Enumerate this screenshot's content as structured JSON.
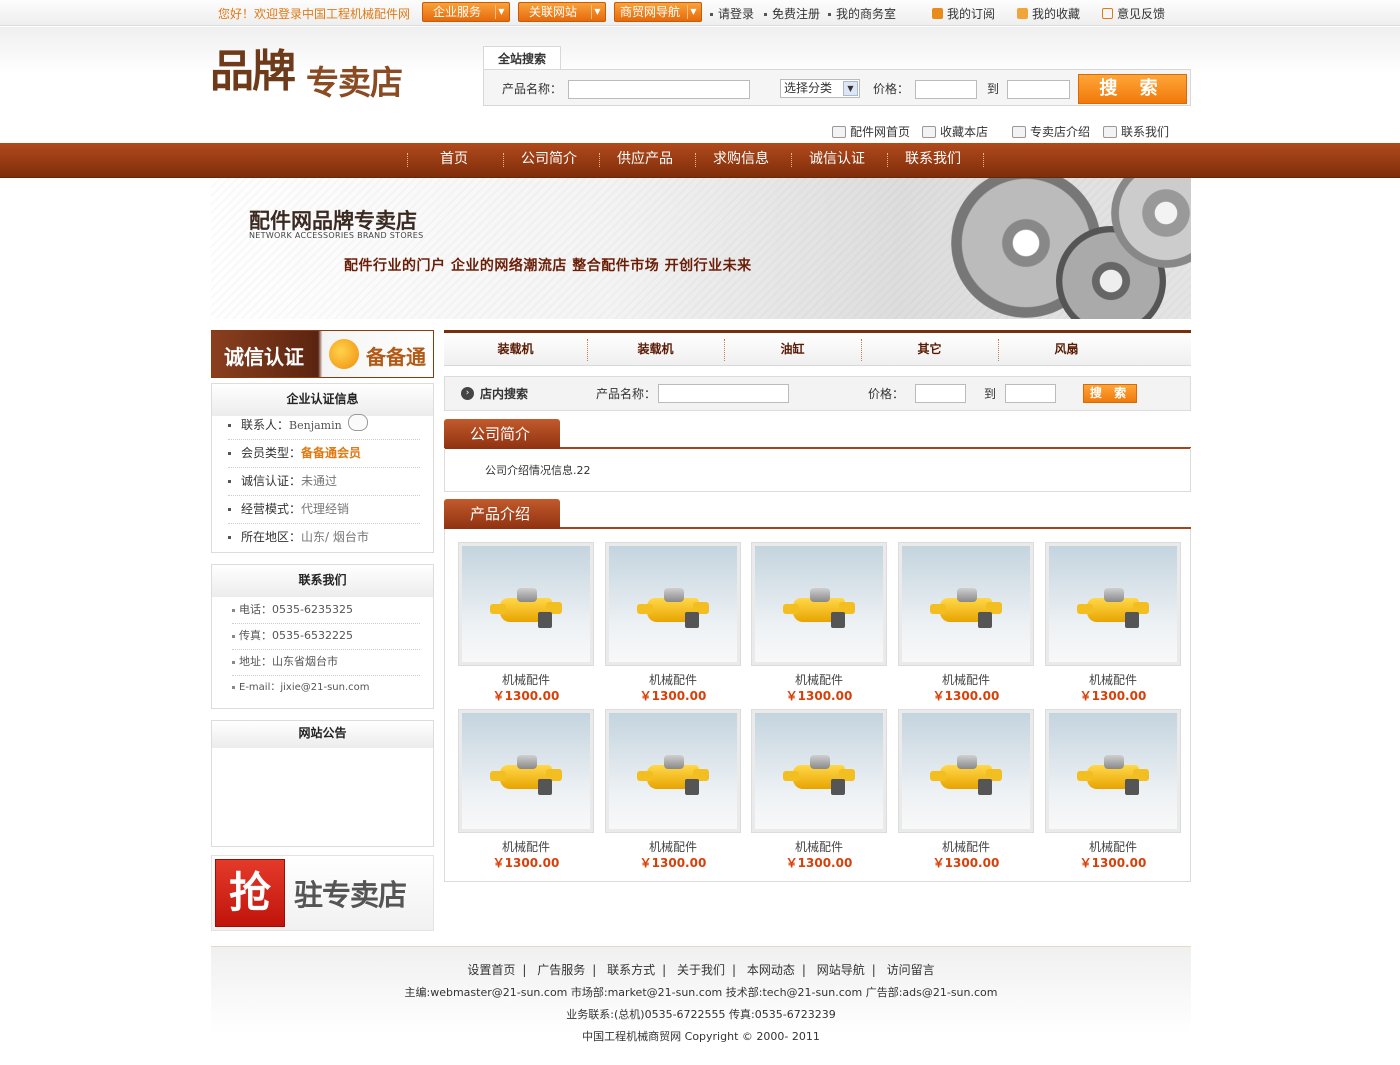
{
  "topbar": {
    "welcome": "您好！欢迎登录中国工程机械配件网",
    "dropdowns": [
      "企业服务",
      "关联网站",
      "商贸网导航"
    ],
    "links": [
      "请登录",
      "免费注册",
      "我的商务室"
    ],
    "right_links": [
      "我的订阅",
      "我的收藏",
      "意见反馈"
    ]
  },
  "logo": {
    "part1": "品牌",
    "part2": "专卖店"
  },
  "search": {
    "tab": "全站搜索",
    "name_label": "产品名称：",
    "category": "选择分类",
    "price_label": "价格：",
    "to_label": "到",
    "button": "搜 索"
  },
  "sublinks": [
    "配件网首页",
    "收藏本店",
    "专卖店介绍",
    "联系我们"
  ],
  "nav": [
    "首页",
    "公司简介",
    "供应产品",
    "求购信息",
    "诚信认证",
    "联系我们"
  ],
  "banner": {
    "title": "配件网品牌专卖店",
    "subtitle": "NETWORK ACCESSORIES BRAND STORES",
    "slogan": "配件行业的门户  企业的网络潮流店  整合配件市场  开创行业未来"
  },
  "cert": {
    "title": "诚信认证",
    "badge": "备备通"
  },
  "company_info": {
    "title": "企业认证信息",
    "rows": [
      {
        "label": "联系人：",
        "value": "Benjamin"
      },
      {
        "label": "会员类型：",
        "value": "备备通会员"
      },
      {
        "label": "诚信认证：",
        "value": "未通过"
      },
      {
        "label": "经营模式：",
        "value": "代理经销"
      },
      {
        "label": "所在地区：",
        "value": "山东/ 烟台市"
      }
    ]
  },
  "contact": {
    "title": "联系我们",
    "rows": [
      "电话：0535-6235325",
      "传真：0535-6532225",
      "地址：山东省烟台市",
      "E-mail：jixie@21-sun.com"
    ]
  },
  "notice": {
    "title": "网站公告"
  },
  "grab": {
    "q": "抢",
    "text": "驻专卖店"
  },
  "categories": [
    "装载机",
    "装载机",
    "油缸",
    "其它",
    "风扇"
  ],
  "shop_search": {
    "title": "店内搜索",
    "name_label": "产品名称：",
    "price_label": "价格：",
    "to_label": "到",
    "button": "搜 索"
  },
  "intro": {
    "tab": "公司简介",
    "text": "公司介绍情况信息.22"
  },
  "products": {
    "tab": "产品介绍",
    "items": [
      {
        "name": "机械配件",
        "price": "￥1300.00"
      },
      {
        "name": "机械配件",
        "price": "￥1300.00"
      },
      {
        "name": "机械配件",
        "price": "￥1300.00"
      },
      {
        "name": "机械配件",
        "price": "￥1300.00"
      },
      {
        "name": "机械配件",
        "price": "￥1300.00"
      },
      {
        "name": "机械配件",
        "price": "￥1300.00"
      },
      {
        "name": "机械配件",
        "price": "￥1300.00"
      },
      {
        "name": "机械配件",
        "price": "￥1300.00"
      },
      {
        "name": "机械配件",
        "price": "￥1300.00"
      },
      {
        "name": "机械配件",
        "price": "￥1300.00"
      }
    ]
  },
  "footer": {
    "links": [
      "设置首页",
      "广告服务",
      "联系方式",
      "关于我们",
      "本网动态",
      "网站导航",
      "访问留言"
    ],
    "line2": "主编:webmaster@21-sun.com 市场部:market@21-sun.com 技术部:tech@21-sun.com 广告部:ads@21-sun.com",
    "line3": "业务联系:(总机)0535-6722555 传真:0535-6723239",
    "line4": "中国工程机械商贸网 Copyright © 2000- 2011"
  },
  "colors": {
    "brand": "#8f3211",
    "accent": "#f07a0b",
    "price": "#d8400a"
  }
}
